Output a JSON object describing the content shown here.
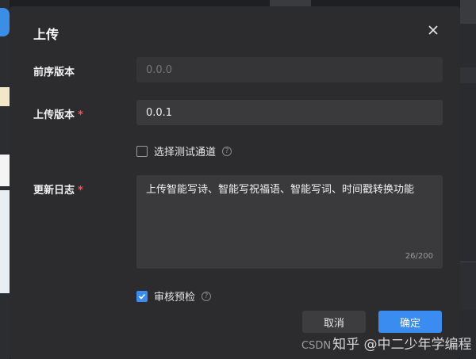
{
  "dialog": {
    "title": "上传",
    "close_icon": "close-icon"
  },
  "form": {
    "prev_version": {
      "label": "前序版本",
      "value": "0.0.0"
    },
    "upload_version": {
      "label": "上传版本",
      "required_mark": "*",
      "value": "0.0.1"
    },
    "test_channel": {
      "label": "选择测试通道",
      "checked": false,
      "help_icon": "help-circle-icon"
    },
    "changelog": {
      "label": "更新日志",
      "required_mark": "*",
      "value": "上传智能写诗、智能写祝福语、智能写词、时间戳转换功能",
      "counter": "26/200"
    },
    "audit_precheck": {
      "label": "审核预检",
      "checked": true,
      "help_icon": "help-circle-icon"
    }
  },
  "buttons": {
    "cancel": "取消",
    "confirm": "确定"
  },
  "watermark": {
    "csdn": "CSDN",
    "text": "知乎 @中二少年学编程"
  },
  "colors": {
    "accent": "#3b8cf0",
    "dialog_bg": "#2c2c2e",
    "required": "#ff4d4f"
  }
}
